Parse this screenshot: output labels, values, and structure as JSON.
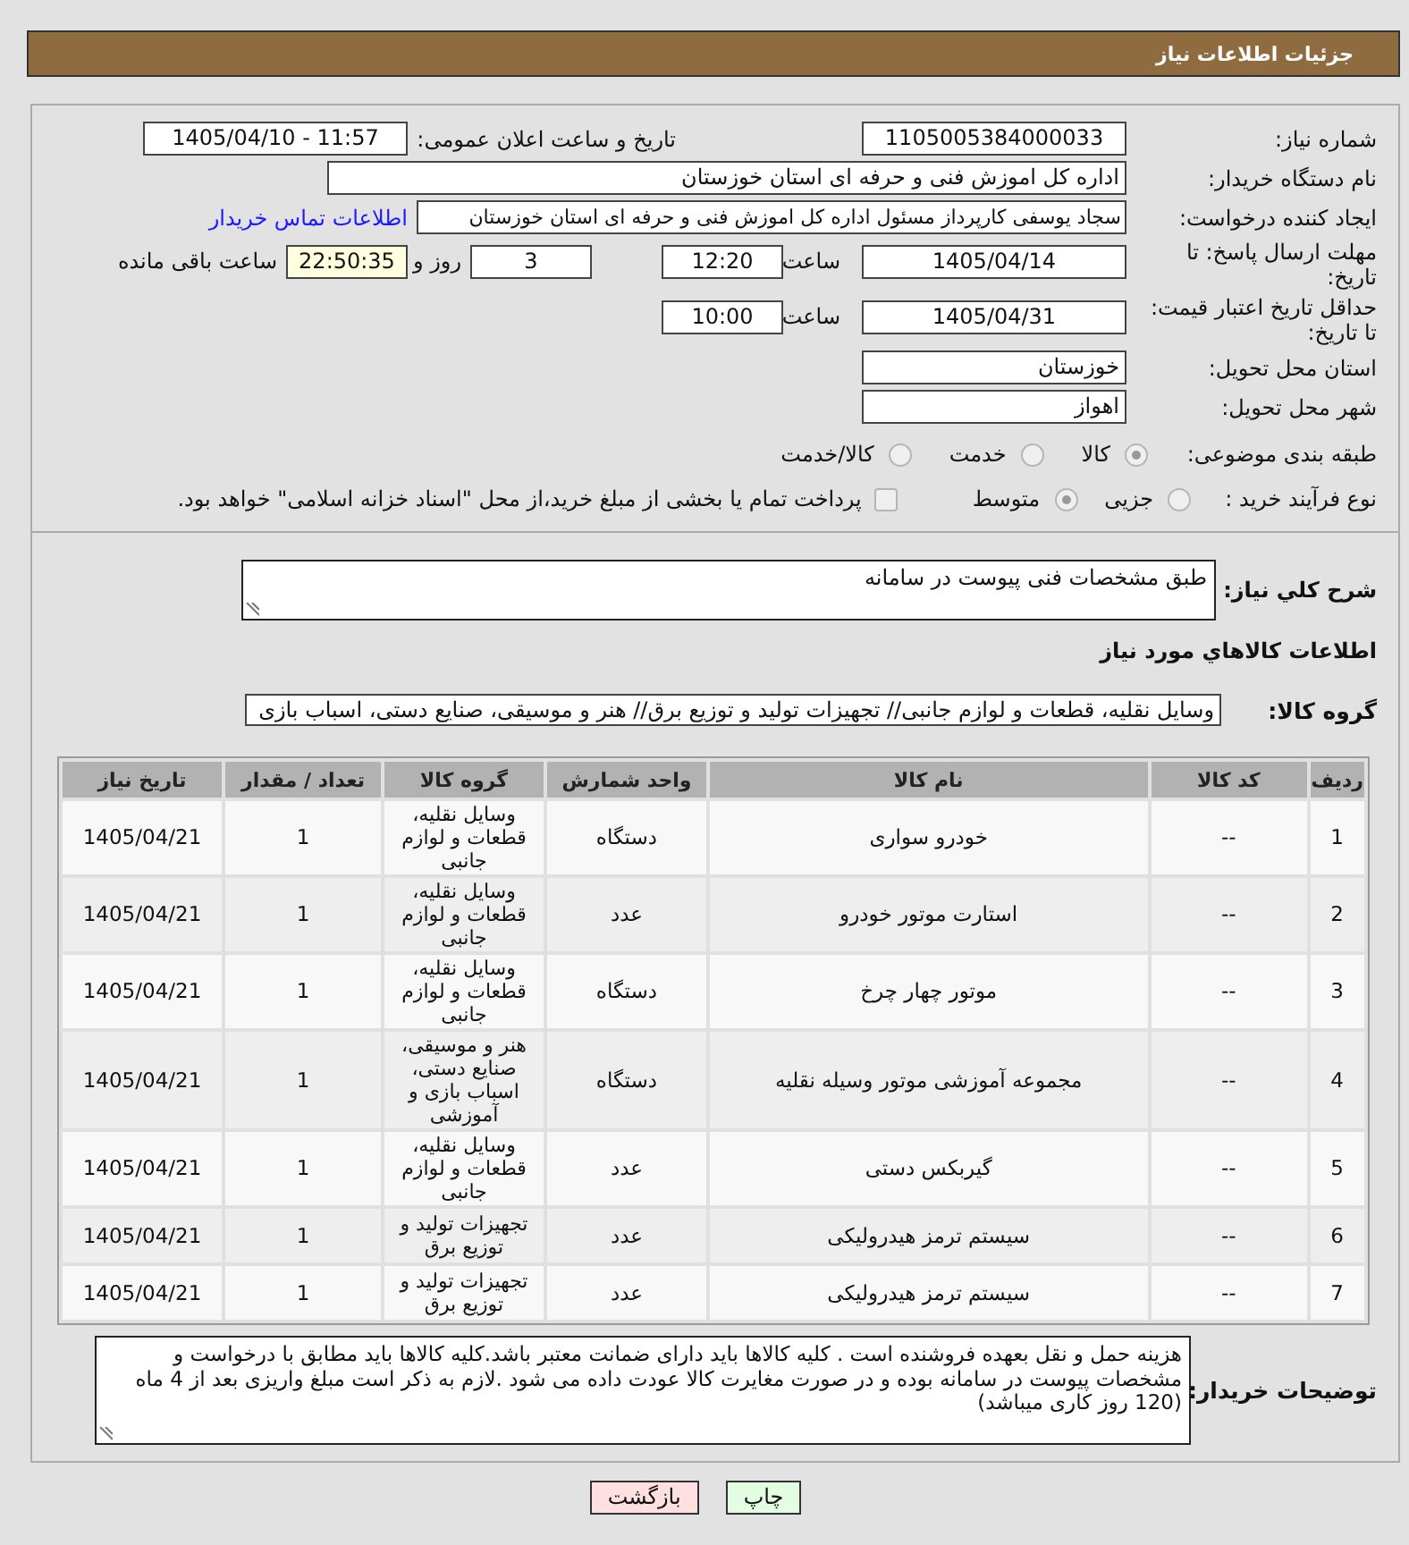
{
  "header": {
    "title": "جزئیات اطلاعات نیاز"
  },
  "form": {
    "need_number": {
      "label": "شماره نیاز:",
      "value": "1105005384000033"
    },
    "announce_datetime": {
      "label": "تاریخ و ساعت اعلان عمومی:",
      "value": "1405/04/10 - 11:57"
    },
    "buyer_org": {
      "label": "نام دستگاه خریدار:",
      "value": "اداره کل اموزش فنی و حرفه ای استان خوزستان"
    },
    "requester": {
      "label": "ایجاد کننده درخواست:",
      "value": "سجاد یوسفی کارپرداز مسئول اداره کل اموزش فنی و حرفه ای استان خوزستان",
      "link": "اطلاعات تماس خریدار"
    },
    "response_deadline": {
      "label": "مهلت ارسال پاسخ: تا تاریخ:",
      "date": "1405/04/14",
      "time_label": "ساعت",
      "time": "12:20",
      "days": "3",
      "days_label": "روز و",
      "remaining": "22:50:35",
      "remaining_label": "ساعت باقی مانده"
    },
    "price_validity": {
      "label": "حداقل تاریخ اعتبار قیمت: تا تاریخ:",
      "date": "1405/04/31",
      "time_label": "ساعت",
      "time": "10:00"
    },
    "delivery_province": {
      "label": "استان محل تحویل:",
      "value": "خوزستان"
    },
    "delivery_city": {
      "label": "شهر محل تحویل:",
      "value": "اهواز"
    },
    "category": {
      "label": "طبقه بندی موضوعی:",
      "options": [
        {
          "label": "کالا",
          "selected": true
        },
        {
          "label": "خدمت",
          "selected": false
        },
        {
          "label": "کالا/خدمت",
          "selected": false
        }
      ]
    },
    "process_type": {
      "label": "نوع فرآیند خرید :",
      "options": [
        {
          "label": "جزیی",
          "selected": false
        },
        {
          "label": "متوسط",
          "selected": true
        }
      ],
      "treasury": {
        "label": "پرداخت تمام یا بخشی از مبلغ خرید،از محل \"اسناد خزانه اسلامی\" خواهد بود.",
        "checked": false
      }
    }
  },
  "description": {
    "label": "شرح کلي نیاز:",
    "value": "طبق مشخصات فنی پیوست در سامانه"
  },
  "goods": {
    "title": "اطلاعات کالاهاي مورد نیاز",
    "group_label": "گروه کالا:",
    "group_value": "وسایل نقلیه، قطعات و لوازم جانبی// تجهیزات تولید و توزیع برق// هنر و موسیقی، صنایع دستی، اسباب بازی",
    "table": {
      "columns": [
        "ردیف",
        "کد کالا",
        "نام کالا",
        "واحد شمارش",
        "گروه کالا",
        "تعداد / مقدار",
        "تاریخ نیاز"
      ],
      "rows": [
        {
          "row": "1",
          "code": "--",
          "name": "خودرو سواری",
          "unit": "دستگاه",
          "group": "وسایل نقلیه، قطعات و لوازم جانبی",
          "quantity": "1",
          "need_date": "1405/04/21"
        },
        {
          "row": "2",
          "code": "--",
          "name": "استارت موتور خودرو",
          "unit": "عدد",
          "group": "وسایل نقلیه، قطعات و لوازم جانبی",
          "quantity": "1",
          "need_date": "1405/04/21"
        },
        {
          "row": "3",
          "code": "--",
          "name": "موتور چهار چرخ",
          "unit": "دستگاه",
          "group": "وسایل نقلیه، قطعات و لوازم جانبی",
          "quantity": "1",
          "need_date": "1405/04/21"
        },
        {
          "row": "4",
          "code": "--",
          "name": "مجموعه آموزشی موتور وسیله نقلیه",
          "unit": "دستگاه",
          "group": "هنر و موسیقی، صنایع دستی، اسباب بازی و آموزشی",
          "quantity": "1",
          "need_date": "1405/04/21"
        },
        {
          "row": "5",
          "code": "--",
          "name": "گیربکس دستی",
          "unit": "عدد",
          "group": "وسایل نقلیه، قطعات و لوازم جانبی",
          "quantity": "1",
          "need_date": "1405/04/21"
        },
        {
          "row": "6",
          "code": "--",
          "name": "سیستم ترمز هیدرولیکی",
          "unit": "عدد",
          "group": "تجهیزات تولید و توزیع برق",
          "quantity": "1",
          "need_date": "1405/04/21"
        },
        {
          "row": "7",
          "code": "--",
          "name": "سیستم ترمز هیدرولیکی",
          "unit": "عدد",
          "group": "تجهیزات تولید و توزیع برق",
          "quantity": "1",
          "need_date": "1405/04/21"
        }
      ]
    }
  },
  "buyer_notes": {
    "label": "توضیحات خریدار:",
    "value": "هزینه حمل و نقل بعهده فروشنده است . کلیه کالاها باید دارای ضمانت معتبر باشد.کلیه کالاها باید مطابق با درخواست و مشخصات پیوست در سامانه بوده و در صورت مغایرت کالا عودت داده می شود .لازم به ذکر است مبلغ واریزی بعد از 4 ماه (120 روز کاری میباشد)"
  },
  "buttons": [
    {
      "label": "چاپ",
      "kind": "print"
    },
    {
      "label": "بازگشت",
      "kind": "back"
    }
  ]
}
